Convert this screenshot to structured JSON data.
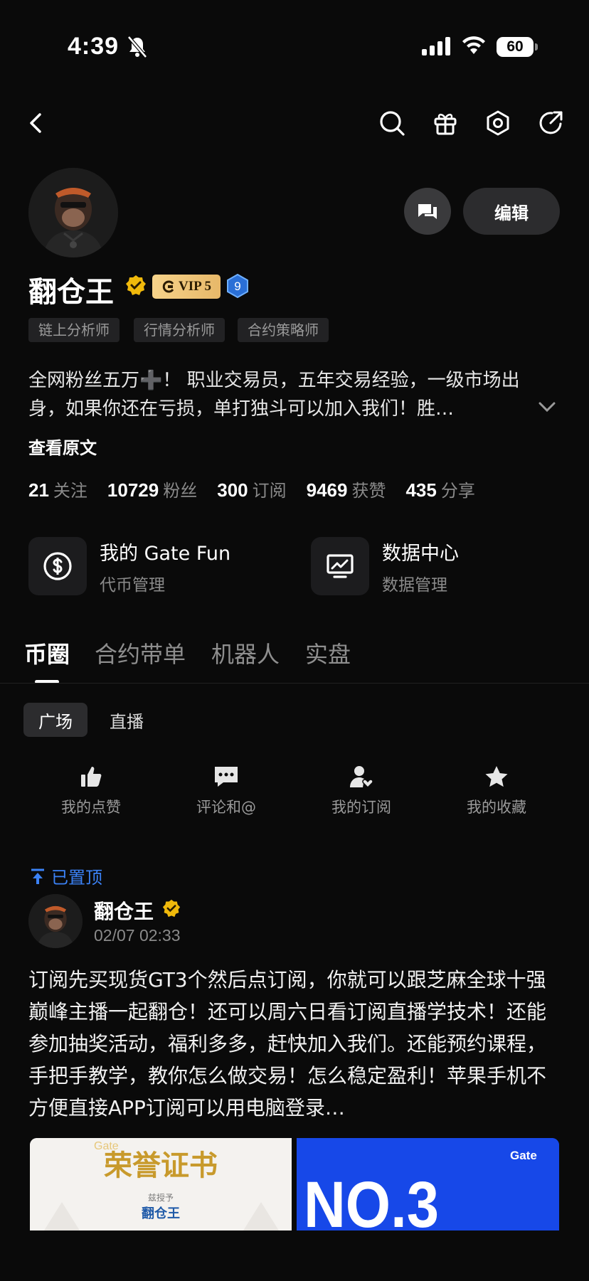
{
  "status_bar": {
    "time": "4:39",
    "battery": "60"
  },
  "header": {
    "back": "back",
    "icons": [
      "search-icon",
      "gift-icon",
      "settings-icon",
      "share-icon"
    ]
  },
  "profile": {
    "name": "翻仓王",
    "vip_label": "VIP 5",
    "level": "9",
    "edit_label": "编辑",
    "tags": [
      "链上分析师",
      "行情分析师",
      "合约策略师"
    ],
    "bio": "全网粉丝五万➕！ 职业交易员，五年交易经验，一级市场出身，如果你还在亏损，单打独斗可以加入我们！胜…",
    "read_more": "查看原文",
    "stats": [
      {
        "num": "21",
        "label": "关注"
      },
      {
        "num": "10729",
        "label": "粉丝"
      },
      {
        "num": "300",
        "label": "订阅"
      },
      {
        "num": "9469",
        "label": "获赞"
      },
      {
        "num": "435",
        "label": "分享"
      }
    ]
  },
  "cards": [
    {
      "title": "我的 Gate Fun",
      "subtitle": "代币管理",
      "icon": "dollar-icon"
    },
    {
      "title": "数据中心",
      "subtitle": "数据管理",
      "icon": "chart-monitor-icon"
    }
  ],
  "tabs": [
    "币圈",
    "合约带单",
    "机器人",
    "实盘"
  ],
  "subtabs": [
    "广场",
    "直播"
  ],
  "quick_actions": [
    {
      "label": "我的点赞",
      "icon": "thumbs-up-icon"
    },
    {
      "label": "评论和@",
      "icon": "comment-icon"
    },
    {
      "label": "我的订阅",
      "icon": "subscribe-icon"
    },
    {
      "label": "我的收藏",
      "icon": "star-icon"
    }
  ],
  "post": {
    "pinned_label": "已置顶",
    "author": "翻仓王",
    "time": "02/07 02:33",
    "text": "订阅先买现货GT3个然后点订阅，你就可以跟芝麻全球十强巅峰主播一起翻仓！还可以周六日看订阅直播学技术！还能参加抽奖活动，福利多多，赶快加入我们。还能预约课程，手把手教学，教你怎么做交易！怎么稳定盈利！苹果手机不方便直接APP订阅可以用电脑登录…",
    "images": [
      {
        "title": "荣誉证书",
        "sub": "兹授予",
        "name": "翻仓王",
        "watermark": "Gate"
      },
      {
        "brand": "Gate",
        "text": "NO.3"
      }
    ]
  }
}
